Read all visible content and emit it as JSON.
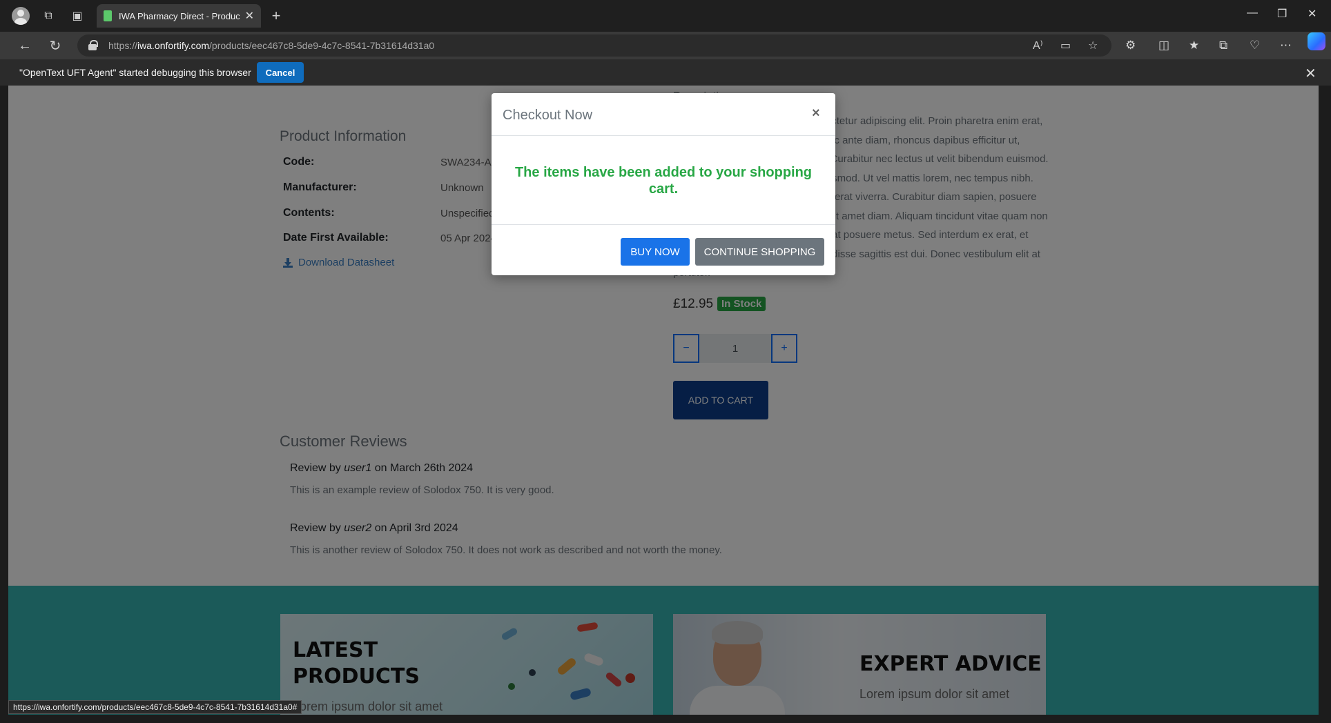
{
  "browser": {
    "tab_title": "IWA Pharmacy Direct - Product :",
    "url_scheme": "https://",
    "url_host": "iwa.onfortify.com",
    "url_path": "/products/eec467c8-5de9-4c7c-8541-7b31614d31a0",
    "status_url": "https://iwa.onfortify.com/products/eec467c8-5de9-4c7c-8541-7b31614d31a0#"
  },
  "infobar": {
    "message": "\"OpenText UFT Agent\" started debugging this browser",
    "cancel_label": "Cancel"
  },
  "product_info": {
    "heading": "Product Information",
    "code_label": "Code:",
    "code_value": "SWA234-A568-00010",
    "manufacturer_label": "Manufacturer:",
    "manufacturer_value": "Unknown",
    "contents_label": "Contents:",
    "contents_value": "Unspecified",
    "date_label": "Date First Available:",
    "date_value": "05 Apr 2024",
    "download_label": "Download Datasheet"
  },
  "description": {
    "heading": "Description",
    "text": "Lorem ipsum dolor sit amet, consectetur adipiscing elit. Proin pharetra enim erat, sed tempor mauris viverra in. Donec ante diam, rhoncus dapibus efficitur ut, sollicitudin a metus. Nunc ut sem. Curabitur nec lectus ut velit bibendum euismod. Nulla mattis convallis neque ac euismod. Ut vel mattis lorem, nec tempus nibh. Vivamus tincidunt enim a risus placerat viverra. Curabitur diam sapien, posuere dignissim accumsan sed, tempus sit amet diam. Aliquam tincidunt vitae quam non rutrum. Nunc id sollicitudin neque, at posuere metus. Sed interdum ex erat, et ornare purus bibendum id. Suspendisse sagittis est dui. Donec vestibulum elit at porttitor."
  },
  "purchase": {
    "price": "£12.95",
    "stock_badge": "In Stock",
    "qty_minus": "−",
    "qty_value": "1",
    "qty_plus": "+",
    "add_to_cart": "ADD TO CART"
  },
  "reviews": {
    "heading": "Customer Reviews",
    "items": [
      {
        "prefix": "Review by ",
        "user": "user1",
        "suffix": " on March 26th 2024",
        "text": "This is an example review of Solodox 750. It is very good."
      },
      {
        "prefix": "Review by ",
        "user": "user2",
        "suffix": " on April 3rd 2024",
        "text": "This is another review of Solodox 750. It does not work as described and not worth the money."
      }
    ]
  },
  "promos": {
    "left_title_line1": "LATEST",
    "left_title_line2": "PRODUCTS",
    "left_sub": "Lorem ipsum dolor sit amet",
    "right_title": "EXPERT ADVICE",
    "right_sub": "Lorem ipsum dolor sit amet"
  },
  "modal": {
    "title": "Checkout Now",
    "close": "×",
    "message": "The items have been added to your shopping cart.",
    "buy_now": "BUY NOW",
    "continue": "CONTINUE SHOPPING"
  },
  "colors": {
    "accent_blue": "#1a73e8",
    "success_green": "#28a745",
    "banner_teal": "#36b5b3",
    "secondary_grey": "#6c757d"
  }
}
